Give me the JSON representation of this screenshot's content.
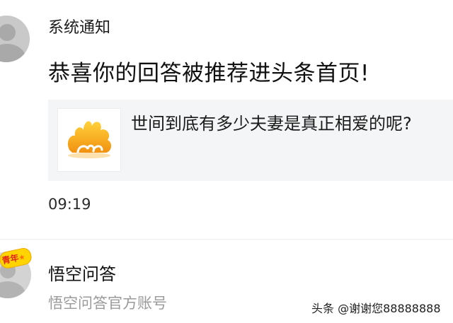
{
  "notification": {
    "sender": "系统通知",
    "message": "恭喜你的回答被推荐进头条首页!",
    "card": {
      "thumbnail_icon": "golden-cloud-logo",
      "question": "世间到底有多少夫妻是真正相爱的呢?"
    },
    "time": "09:19"
  },
  "conversation": {
    "badge": "青年",
    "title": "悟空问答",
    "subtitle": "悟空问答官方账号"
  },
  "watermark": "头条 @谢谢您88888888",
  "colors": {
    "card_background": "#f4f5f6",
    "subtitle_gray": "#9a9a9a",
    "logo_gold": "#f7a81b",
    "badge_yellow": "#ffd400",
    "badge_red": "#e2231a"
  }
}
